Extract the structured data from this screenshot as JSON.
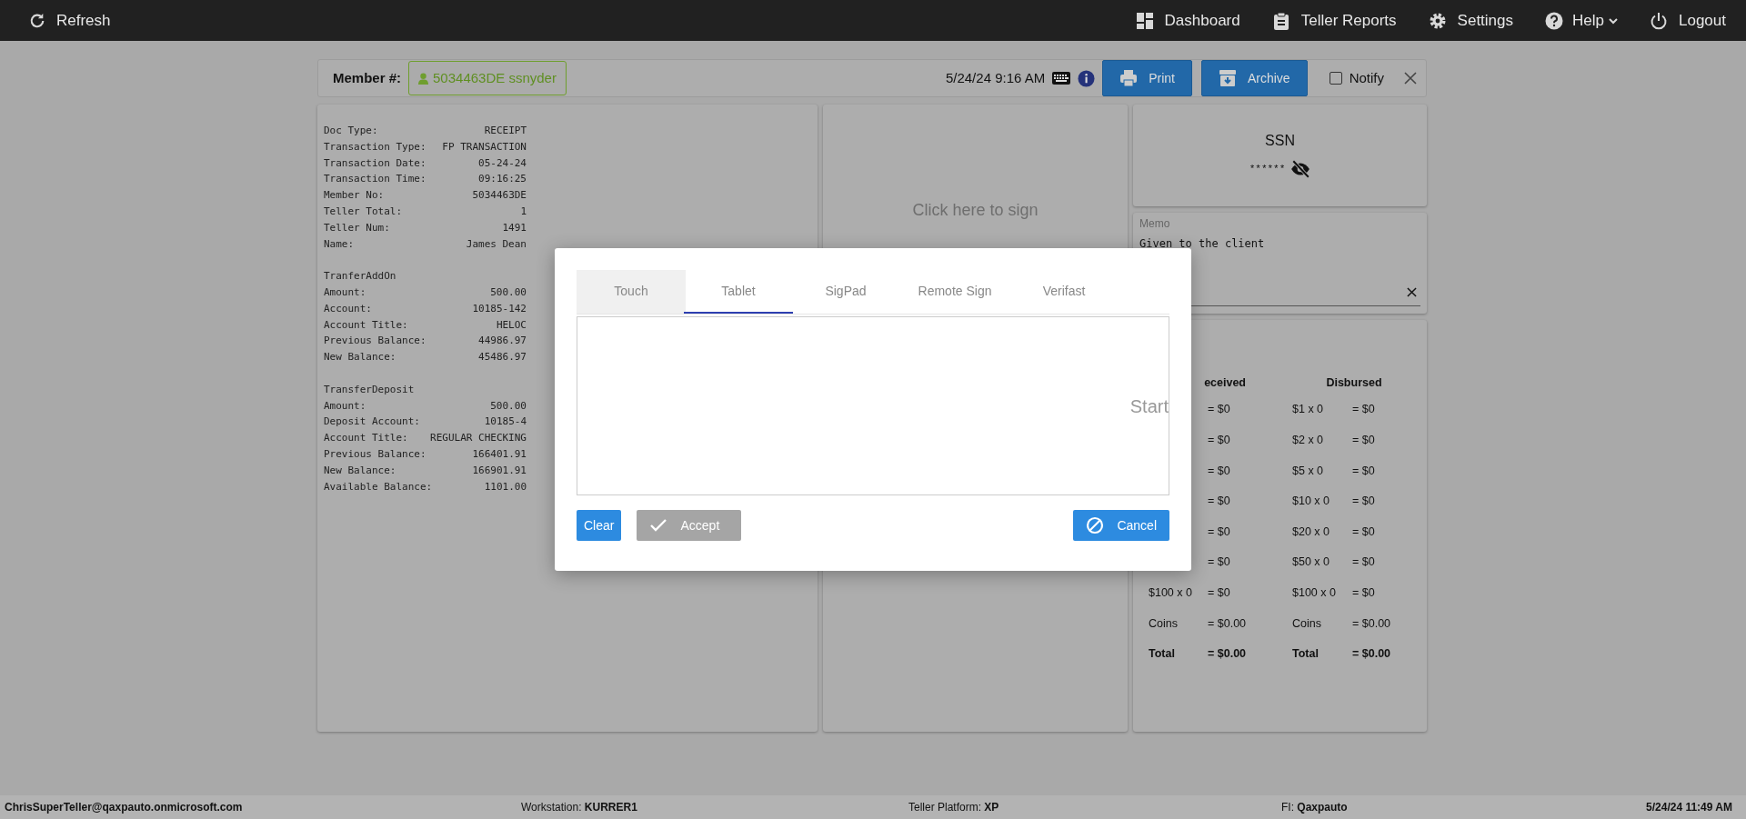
{
  "navbar": {
    "left": [
      {
        "label": "Refresh"
      }
    ],
    "right": [
      {
        "label": "Dashboard",
        "has_menu": false
      },
      {
        "label": "Teller Reports",
        "has_menu": false
      },
      {
        "label": "Settings",
        "has_menu": false
      },
      {
        "label": "Help",
        "has_menu": true
      },
      {
        "label": "Logout",
        "has_menu": false
      }
    ]
  },
  "member_bar": {
    "label": "Member #:",
    "member": "5034463DE ssnyder",
    "datetime": "5/24/24 9:16 AM",
    "buttons": [
      "Print",
      "Archive"
    ],
    "notify": {
      "label": "Notify",
      "checked": false
    }
  },
  "receipt": {
    "sections": [
      {
        "lines": [
          [
            "Doc Type:",
            "RECEIPT"
          ],
          [
            "Transaction Type:",
            "FP TRANSACTION"
          ],
          [
            "Transaction Date:",
            "05-24-24"
          ],
          [
            "Transaction Time:",
            "09:16:25"
          ],
          [
            "Member No:",
            "5034463DE"
          ],
          [
            "Teller Total:",
            "1"
          ],
          [
            "Teller Num:",
            "1491"
          ],
          [
            "Name:",
            "James Dean"
          ]
        ]
      },
      {
        "heading": "TranferAddOn",
        "lines": [
          [
            "Amount:",
            "500.00"
          ],
          [
            "Account:",
            "10185-142"
          ],
          [
            "Account Title:",
            "HELOC"
          ],
          [
            "Previous Balance:",
            "44986.97"
          ],
          [
            "New Balance:",
            "45486.97"
          ]
        ]
      },
      {
        "heading": "TransferDeposit",
        "lines": [
          [
            "Amount:",
            "500.00"
          ],
          [
            "Deposit Account:",
            "10185-4"
          ],
          [
            "Account Title:",
            "REGULAR CHECKING"
          ],
          [
            "Previous Balance:",
            "166401.91"
          ],
          [
            "New Balance:",
            "166901.91"
          ],
          [
            "Available Balance:",
            "1101.00"
          ]
        ]
      }
    ]
  },
  "signature_panel": {
    "prompt": "Click here to sign"
  },
  "ssn": {
    "title": "SSN",
    "value": "******",
    "masked": true
  },
  "memo": {
    "label": "Memo",
    "value": "Given to the client"
  },
  "cash": {
    "received": {
      "heading": "eceived",
      "rows": [
        {
          "amount": "= $0",
          "kind": "row"
        },
        {
          "amount": "= $0",
          "kind": "row"
        },
        {
          "amount": "= $0",
          "kind": "row"
        },
        {
          "amount": "= $0",
          "kind": "row"
        },
        {
          "amount": "= $0",
          "kind": "row"
        },
        {
          "amount": "= $0",
          "kind": "row"
        },
        {
          "denomination": "$100 x 0",
          "amount": "= $0",
          "kind": "row"
        },
        {
          "denomination": "Coins",
          "amount": "= $0.00",
          "kind": "row"
        },
        {
          "denomination": "Total",
          "amount": "= $0.00",
          "kind": "total"
        }
      ]
    },
    "disbursed": {
      "heading": "Disbursed",
      "rows": [
        {
          "denomination": "$1 x 0",
          "amount": "= $0",
          "kind": "row"
        },
        {
          "denomination": "$2 x 0",
          "amount": "= $0",
          "kind": "row"
        },
        {
          "denomination": "$5 x 0",
          "amount": "= $0",
          "kind": "row"
        },
        {
          "denomination": "$10 x 0",
          "amount": "= $0",
          "kind": "row"
        },
        {
          "denomination": "$20 x 0",
          "amount": "= $0",
          "kind": "row"
        },
        {
          "denomination": "$50 x 0",
          "amount": "= $0",
          "kind": "row"
        },
        {
          "denomination": "$100 x 0",
          "amount": "= $0",
          "kind": "row"
        },
        {
          "denomination": "Coins",
          "amount": "= $0.00",
          "kind": "row"
        },
        {
          "denomination": "Total",
          "amount": "= $0.00",
          "kind": "total"
        }
      ]
    }
  },
  "modal": {
    "tabs": [
      {
        "label": "Touch",
        "selected": false,
        "focused": true
      },
      {
        "label": "Tablet",
        "selected": true,
        "focused": false
      },
      {
        "label": "SigPad",
        "selected": false,
        "focused": false
      },
      {
        "label": "Remote Sign",
        "selected": false,
        "focused": false
      },
      {
        "label": "Verifast",
        "selected": false,
        "focused": false
      }
    ],
    "pad_hint": "Start",
    "buttons": [
      {
        "label": "Clear",
        "disabled": false
      },
      {
        "label": "Accept",
        "disabled": true
      },
      {
        "label": "Cancel",
        "disabled": false
      }
    ]
  },
  "status_bar": {
    "user": "ChrisSuperTeller@qaxpauto.onmicrosoft.com",
    "workstation": "Workstation: **KURRER1**",
    "platform": "Teller Platform: **XP**",
    "fi": "FI: **Qaxpauto**",
    "time": "5/24/24 11:49 AM"
  }
}
